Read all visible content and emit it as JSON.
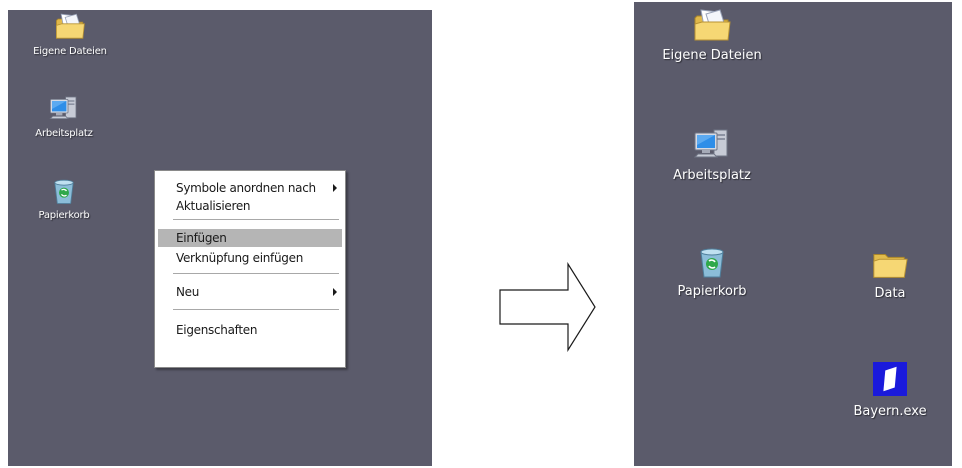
{
  "left_desktop": {
    "icons": [
      {
        "label": "Eigene Dateien",
        "icon": "my-documents-icon"
      },
      {
        "label": "Arbeitsplatz",
        "icon": "my-computer-icon"
      },
      {
        "label": "Papierkorb",
        "icon": "recycle-bin-icon"
      }
    ],
    "context_menu": {
      "items": [
        {
          "label": "Symbole anordnen nach",
          "submenu": true
        },
        {
          "label": "Aktualisieren"
        },
        {
          "label": "Einfügen",
          "highlighted": true
        },
        {
          "label": "Verknüpfung einfügen"
        },
        {
          "label": "Neu",
          "submenu": true
        },
        {
          "label": "Eigenschaften"
        }
      ]
    }
  },
  "right_desktop": {
    "icons": [
      {
        "label": "Eigene Dateien",
        "icon": "my-documents-icon"
      },
      {
        "label": "Arbeitsplatz",
        "icon": "my-computer-icon"
      },
      {
        "label": "Papierkorb",
        "icon": "recycle-bin-icon"
      },
      {
        "label": "Data",
        "icon": "folder-icon"
      },
      {
        "label": "Bayern.exe",
        "icon": "bayern-exe-icon"
      }
    ]
  },
  "colors": {
    "desktop_bg": "#5b5b6b",
    "menu_highlight": "#b5b5b5",
    "folder_yellow": "#f2d36b",
    "exe_blue": "#1a1adb"
  }
}
